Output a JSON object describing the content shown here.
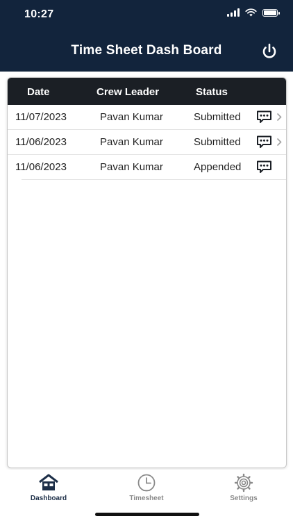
{
  "status_bar": {
    "time": "10:27"
  },
  "header": {
    "title": "Time Sheet Dash Board"
  },
  "table": {
    "columns": [
      "Date",
      "Crew Leader",
      "Status"
    ],
    "rows": [
      {
        "date": "11/07/2023",
        "crew_leader": "Pavan Kumar",
        "status": "Submitted"
      },
      {
        "date": "11/06/2023",
        "crew_leader": "Pavan Kumar",
        "status": "Submitted"
      },
      {
        "date": "11/06/2023",
        "crew_leader": "Pavan Kumar",
        "status": "Appended"
      }
    ]
  },
  "tabs": [
    {
      "label": "Dashboard"
    },
    {
      "label": "Timesheet"
    },
    {
      "label": "Settings"
    }
  ],
  "colors": {
    "header_bg": "#12243c",
    "table_header_bg": "#1b1f25",
    "active_tab": "#1d2f48",
    "inactive_tab": "#8a8a8a"
  }
}
